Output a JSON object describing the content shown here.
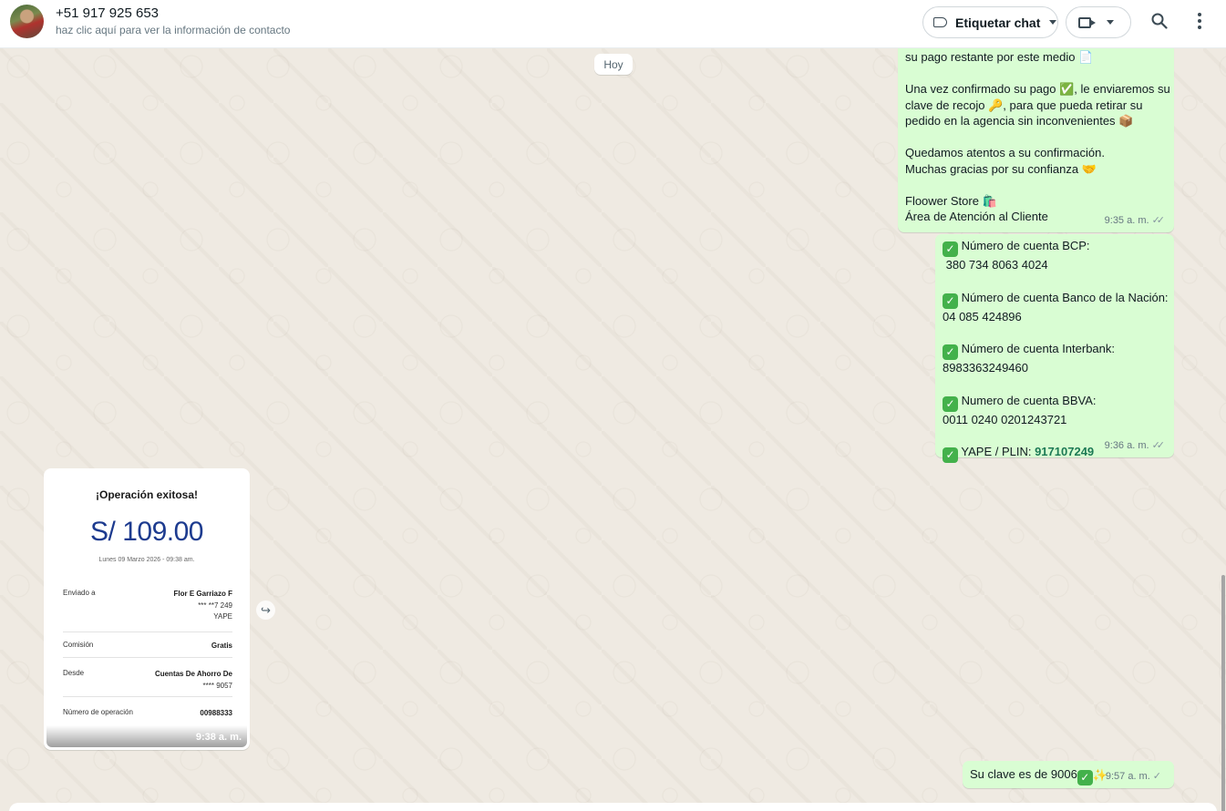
{
  "header": {
    "contact_name": "+51 917 925 653",
    "contact_sub": "haz clic aquí para ver la información de contacto",
    "label_button": "Etiquetar chat"
  },
  "date_chip": "Hoy",
  "messages": {
    "m1": {
      "lines": [
        "su pago restante por este medio 📄",
        "",
        "Una vez confirmado su pago ✅, le enviaremos su",
        "clave de recojo 🔑, para que pueda retirar su",
        "pedido en la agencia sin inconvenientes 📦",
        "",
        "Quedamos atentos a su confirmación.",
        "Muchas gracias por su confianza 🤝",
        "",
        "Floower Store 🛍️",
        "Área de Atención al Cliente"
      ],
      "time": "9:35 a. m."
    },
    "m2": {
      "bcp_label": "Número de cuenta BCP:",
      "bcp_value": " 380 734 8063 4024",
      "nacion_label": "Número de cuenta Banco de la Nación:",
      "nacion_value": "04 085 424896",
      "interbank_label": "Número de cuenta Interbank:",
      "interbank_value": "8983363249460",
      "bbva_label": "Numero de cuenta BBVA:",
      "bbva_value": "0011 0240 0201243721",
      "yape_label": "YAPE / PLIN: ",
      "yape_value": "917107249",
      "time": "9:36 a. m."
    },
    "m3": {
      "text": "Su clave es de 9006",
      "time": "9:57 a. m."
    }
  },
  "receipt": {
    "title": "¡Operación exitosa!",
    "amount": "S/ 109.00",
    "date": "Lunes 09 Marzo 2026 - 09:38 am.",
    "sent_to_label": "Enviado a",
    "sent_to_name": "Flor E Garriazo F",
    "sent_to_phone": "*** **7 249",
    "sent_to_app": "YAPE",
    "commission_label": "Comisión",
    "commission_value": "Gratis",
    "from_label": "Desde",
    "from_account": "Cuentas De Ahorro De",
    "from_number": "**** 9057",
    "op_label": "Número de operación",
    "op_value": "00988333",
    "time": "9:38 a. m."
  },
  "icons": {
    "label": "label-icon",
    "video": "video-call-icon",
    "search": "search-icon",
    "menu": "menu-dots-icon",
    "forward": "forward-icon"
  },
  "colors": {
    "outgoing_bubble": "#d9fdd3",
    "chat_background": "#efeae2",
    "link_green": "#1d7a55",
    "receipt_amount": "#1d3b8f"
  }
}
